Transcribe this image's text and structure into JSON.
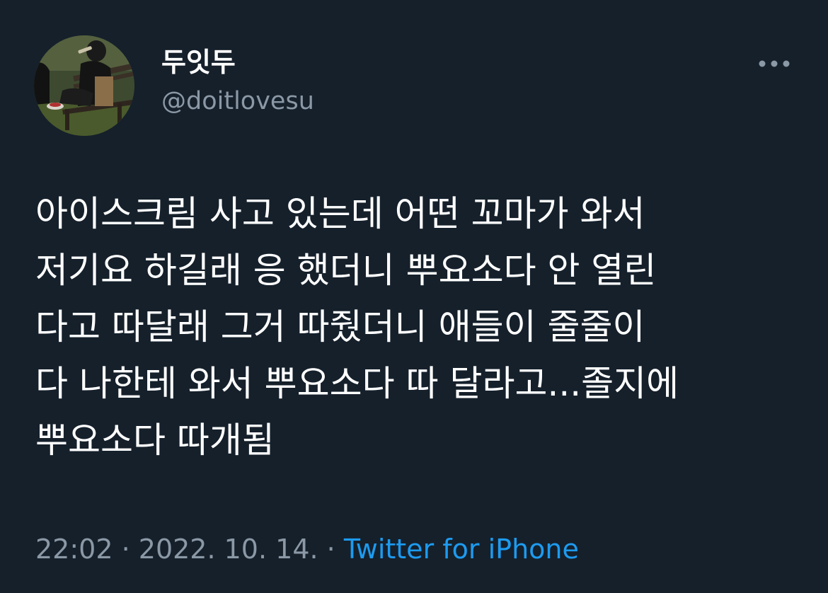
{
  "author": {
    "display_name": "두잇두",
    "handle": "@doitlovesu",
    "avatar_description": "avatar"
  },
  "more_button": {
    "icon": "more-horizontal-icon"
  },
  "tweet": {
    "text": "아이스크림 사고 있는데 어떤 꼬마가 와서\n저기요 하길래 응 했더니 뿌요소다 안 열린\n다고 따달래 그거 따줬더니 애들이 줄줄이\n다 나한테 와서 뿌요소다 따 달라고...졸지에\n뿌요소다 따개됨"
  },
  "meta": {
    "time": "22:02",
    "separator": " · ",
    "date": "2022. 10. 14.",
    "source": "Twitter for iPhone"
  },
  "colors": {
    "background": "#15202b",
    "primary_text": "#ffffff",
    "secondary_text": "#8b98a5",
    "link": "#1d9bf0"
  }
}
